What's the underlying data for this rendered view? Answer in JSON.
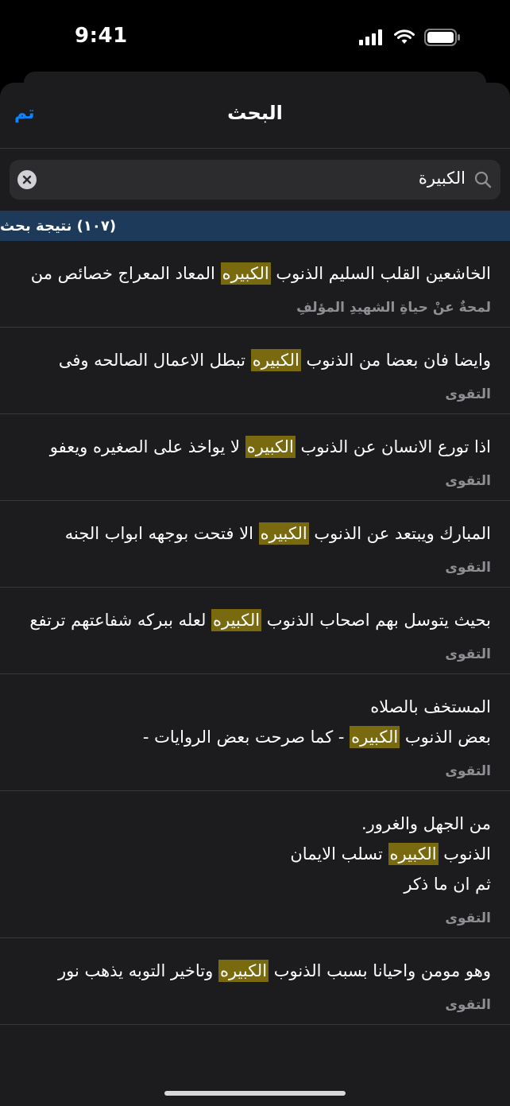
{
  "status": {
    "time": "9:41"
  },
  "nav": {
    "title": "البحث",
    "done_label": "تم"
  },
  "search": {
    "value": "الكبيرة"
  },
  "results_header": "(١٠٧) نتيجة بحث",
  "results": [
    {
      "pre": "الخاشعين القلب السليم الذنوب ",
      "hl": "الكبيره",
      "post": " المعاد المعراج خصائص من",
      "source": "لمحةٌ عنْ حياةِ الشهيدِ المؤلفِ"
    },
    {
      "pre": "وايضا فان بعضا من الذنوب ",
      "hl": "الكبيره",
      "post": " تبطل الاعمال الصالحه وفى",
      "source": "التقوى"
    },
    {
      "pre": "اذا تورع الانسان عن الذنوب ",
      "hl": "الكبيره",
      "post": " لا يواخذ على الصغيره ويعفو",
      "source": "التقوى"
    },
    {
      "pre": "المبارك ويبتعد عن الذنوب ",
      "hl": "الكبيره",
      "post": " الا فتحت بوجهه ابواب الجنه",
      "source": "التقوى"
    },
    {
      "pre": "بحيث يتوسل بهم اصحاب الذنوب ",
      "hl": "الكبيره",
      "post": " لعله ببركه شفاعتهم ترتفع",
      "source": "التقوى"
    },
    {
      "pre": "المستخف بالصلاه\nبعض الذنوب ",
      "hl": "الكبيره",
      "post": " - كما صرحت بعض الروايات -",
      "source": "التقوى"
    },
    {
      "pre": "من الجهل والغرور.\nالذنوب ",
      "hl": "الكبيره",
      "post": " تسلب الايمان\nثم ان ما ذكر",
      "source": "التقوى"
    },
    {
      "pre": "وهو مومن واحيانا بسبب الذنوب ",
      "hl": "الكبيره",
      "post": " وتاخير التوبه يذهب نور",
      "source": "التقوى"
    }
  ]
}
